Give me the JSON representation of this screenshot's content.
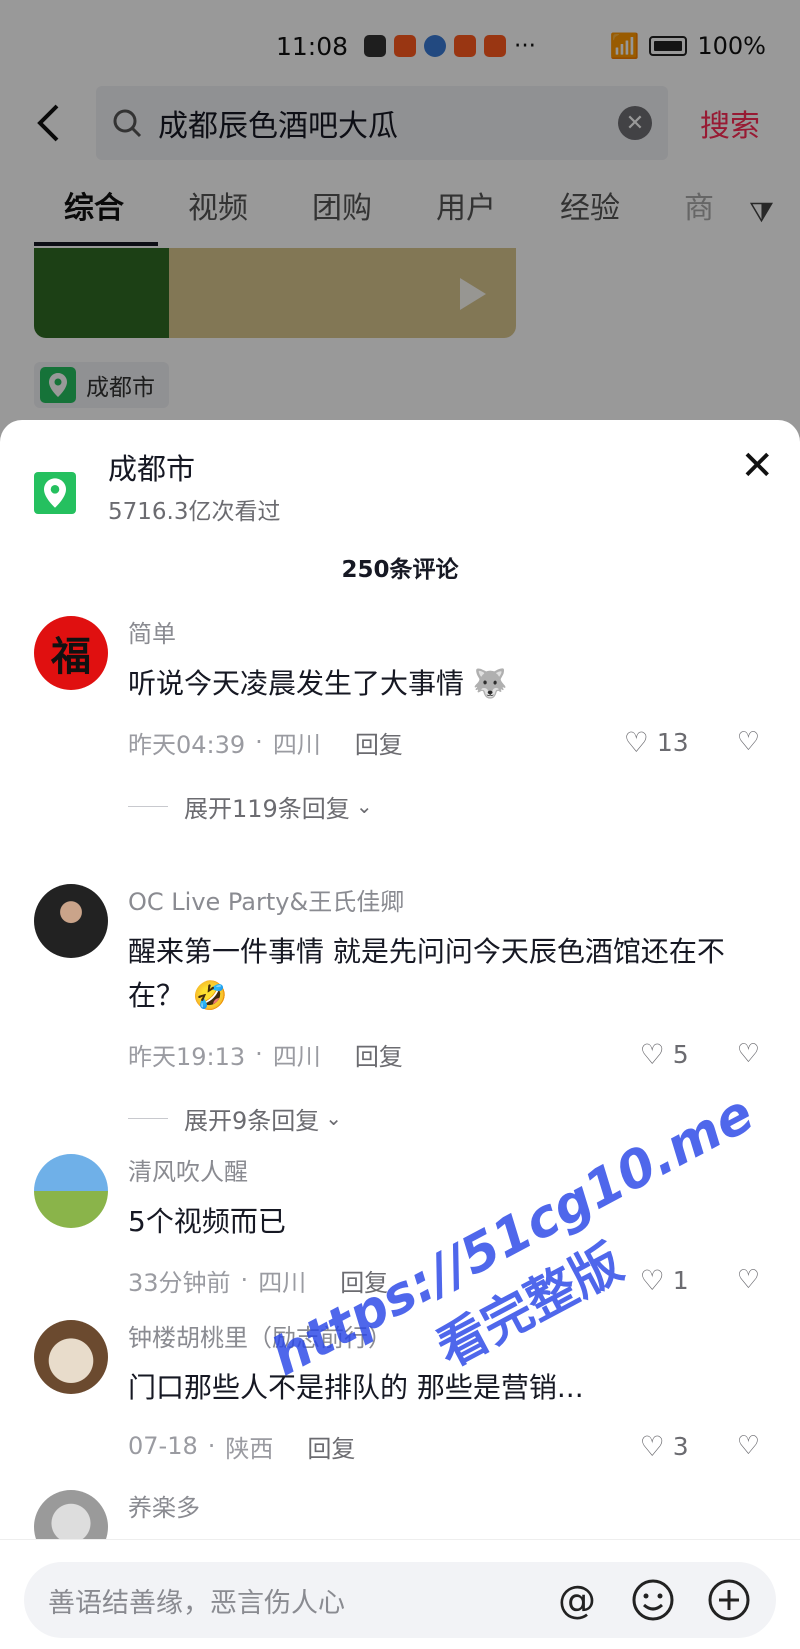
{
  "status_bar": {
    "time": "11:08",
    "more": "···",
    "battery": "100%"
  },
  "search": {
    "query": "成都辰色酒吧大瓜",
    "button": "搜索"
  },
  "tabs": [
    {
      "label": "综合",
      "active": true
    },
    {
      "label": "视频"
    },
    {
      "label": "团购"
    },
    {
      "label": "用户"
    },
    {
      "label": "经验"
    },
    {
      "label": "商"
    }
  ],
  "location_chip": "成都市",
  "sheet": {
    "location_name": "成都市",
    "location_views": "5716.3亿次看过",
    "comment_count": "250条评论"
  },
  "comments": [
    {
      "user": "简单",
      "text": "听说今天凌晨发生了大事情",
      "time": "昨天04:39",
      "region": "四川",
      "reply": "回复",
      "likes": "13",
      "expand": "展开119条回复"
    },
    {
      "user": "OC Live Party&王氏佳卿",
      "text": "醒来第一件事情 就是先问问今天辰色酒馆还在不在？",
      "time": "昨天19:13",
      "region": "四川",
      "reply": "回复",
      "likes": "5",
      "expand": "展开9条回复"
    },
    {
      "user": "清风吹人醒",
      "text": "5个视频而已",
      "time": "33分钟前",
      "region": "四川",
      "reply": "回复",
      "likes": "1"
    },
    {
      "user": "钟楼胡桃里（励志前行）",
      "text": "门口那些人不是排队的 那些是营销...",
      "time": "07-18",
      "region": "陕西",
      "reply": "回复",
      "likes": "3"
    },
    {
      "user": "养楽多"
    }
  ],
  "input": {
    "placeholder": "善语结善缘，恶言伤人心"
  },
  "watermark": {
    "line1": "https://51cg10.me",
    "line2": "看完整版"
  },
  "colors": {
    "accent": "#fe2c55",
    "location_green": "#25c05f",
    "watermark": "#2846e6"
  }
}
